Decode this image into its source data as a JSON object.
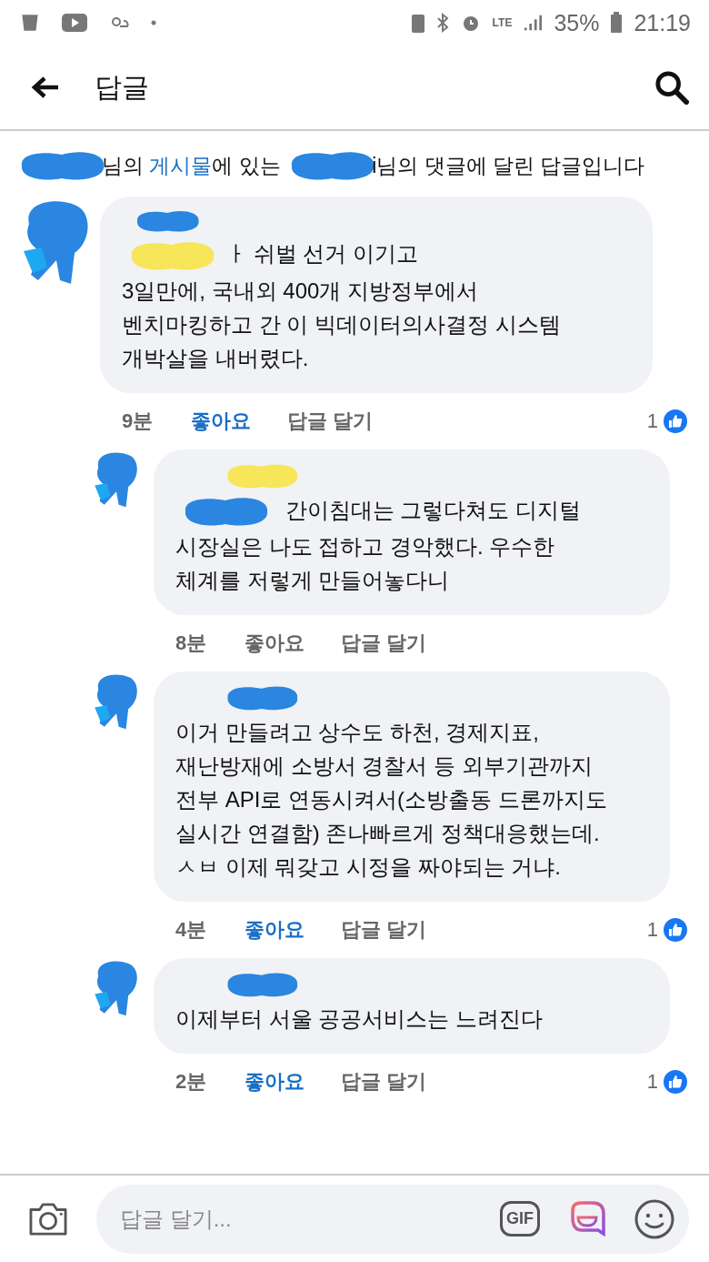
{
  "status_bar": {
    "network": "LTE",
    "battery": "35%",
    "time": "21:19"
  },
  "header": {
    "title": "답글"
  },
  "context": [
    {
      "kind": "redacted",
      "color": "#2a86e0"
    },
    {
      "kind": "text",
      "text": "님의 "
    },
    {
      "kind": "link",
      "text": "게시물"
    },
    {
      "kind": "text",
      "text": "에 있는 "
    },
    {
      "kind": "redacted",
      "color": "#2a86e0"
    },
    {
      "kind": "text",
      "text": "i님의 댓글에 달린 답글입니다"
    }
  ],
  "comments": [
    {
      "name": [
        {
          "kind": "redacted",
          "color": "#2a86e0"
        }
      ],
      "body": [
        {
          "kind": "redacted",
          "color": "#f7e55a"
        },
        {
          "kind": "text",
          "text": "ㅏ 쉬벌 선거 이기고\n3일만에, 국내외 400개 지방정부에서\n벤치마킹하고 간 이 빅데이터의사결정 시스템\n개박살을 내버렸다."
        }
      ],
      "time": "9분",
      "like": "좋아요",
      "liked": true,
      "reply": "답글 달기",
      "reactions": "1",
      "children": [
        {
          "name": [
            {
              "kind": "redacted",
              "color": "#f7e55a"
            }
          ],
          "body": [
            {
              "kind": "redacted",
              "color": "#2a86e0"
            },
            {
              "kind": "text",
              "text": " 간이침대는 그렇다쳐도 디지털\n시장실은 나도 접하고 경악했다. 우수한\n체계를 저렇게 만들어놓다니"
            }
          ],
          "time": "8분",
          "like": "좋아요",
          "liked": false,
          "reply": "답글 달기"
        },
        {
          "name": [
            {
              "kind": "redacted",
              "color": "#2a86e0"
            }
          ],
          "body": [
            {
              "kind": "text",
              "text": "이거 만들려고 상수도 하천, 경제지표,\n재난방재에 소방서 경찰서 등 외부기관까지\n전부 API로 연동시켜서(소방출동 드론까지도\n실시간 연결함) 존나빠르게 정책대응했는데.\nㅅㅂ 이제 뭐갖고 시정을 짜야되는 거냐."
            }
          ],
          "time": "4분",
          "like": "좋아요",
          "liked": true,
          "reply": "답글 달기",
          "reactions": "1"
        },
        {
          "name": [
            {
              "kind": "redacted",
              "color": "#2a86e0"
            }
          ],
          "body": [
            {
              "kind": "text",
              "text": "이제부터 서울 공공서비스는 느려진다"
            }
          ],
          "time": "2분",
          "like": "좋아요",
          "liked": true,
          "reply": "답글 달기",
          "reactions": "1"
        }
      ]
    }
  ],
  "composer": {
    "placeholder": "답글 달기...",
    "gif": "GIF"
  }
}
